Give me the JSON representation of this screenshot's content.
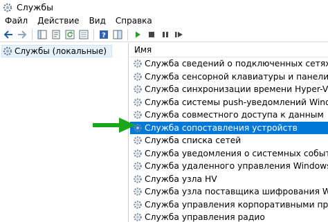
{
  "window": {
    "title": "Службы"
  },
  "menu": [
    "Файл",
    "Действие",
    "Вид",
    "Справка"
  ],
  "toolbar": {
    "buttons": [
      "back-icon",
      "forward-icon",
      "console-tree-icon",
      "properties-icon",
      "refresh-icon",
      "export-list-icon",
      "help-icon",
      "show-hide-icon",
      "play-icon",
      "stop-icon",
      "pause-icon",
      "restart-icon"
    ]
  },
  "tree": {
    "root_label": "Службы (локальные)"
  },
  "list": {
    "column_name": "Имя",
    "rows": [
      "Служба сведений о подключенных сетях",
      "Служба сенсорной клавиатуры и панели рукоп",
      "Служба синхронизации времени Hyper-V",
      "Служба системы push-уведомлений Windows",
      "Служба совместного доступа к данным",
      "Служба сопоставления устройств",
      "Служба списка сетей",
      "Служба уведомления о системных событиях",
      "Служба удаленного управления Windows (WS-",
      "Служба узла HV",
      "Служба узла поставщика шифрования Windows",
      "Служба управления корпоративными приложе",
      "Служба управления радио"
    ],
    "selected_index": 5
  },
  "colors": {
    "selection": "#0078d7",
    "arrow": "#1aa81a"
  }
}
